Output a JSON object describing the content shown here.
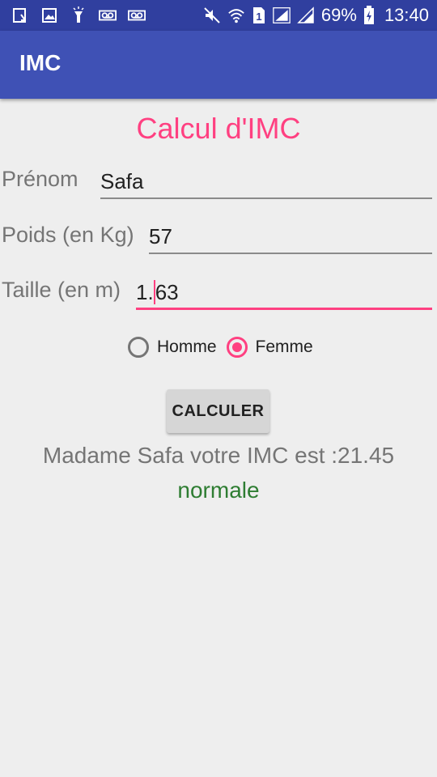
{
  "statusbar": {
    "battery": "69%",
    "time": "13:40",
    "sim": "1",
    "left_icons": [
      "download-icon",
      "image-icon",
      "flashlight-icon",
      "voicemail-icon",
      "voicemail-icon"
    ],
    "right_icons": [
      "mute-icon",
      "wifi-icon",
      "sim-icon",
      "signal-icon",
      "signal-icon",
      "battery-icon"
    ]
  },
  "appbar": {
    "title": "IMC"
  },
  "main": {
    "title": "Calcul d'IMC",
    "prenom_label": "Prénom",
    "prenom_value": "Safa",
    "poids_label": "Poids (en Kg)",
    "poids_value": "57",
    "taille_label": "Taille (en m)",
    "taille_value_before_caret": "1.",
    "taille_value_after_caret": "63",
    "radio_homme": "Homme",
    "radio_femme": "Femme",
    "selected_gender": "Femme",
    "button": "CALCULER",
    "result": "Madame Safa votre IMC est :21.45",
    "category": "normale"
  },
  "colors": {
    "primary": "#3f51b5",
    "primary_dark": "#303f9f",
    "accent": "#ff4081",
    "status_green": "#2e7d32"
  }
}
